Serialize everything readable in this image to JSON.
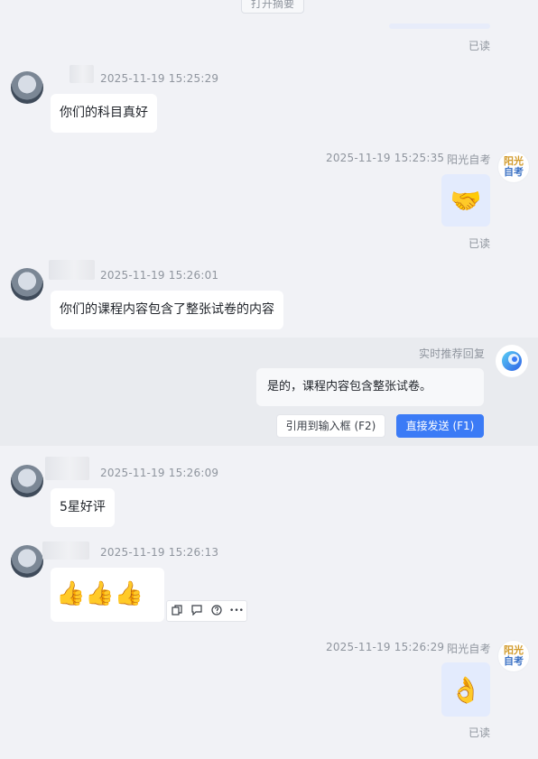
{
  "top": {
    "summary_button": "打开摘要",
    "read_label": "已读"
  },
  "messages": [
    {
      "timestamp": "2025-11-19 15:25:29",
      "text": "你们的科目真好"
    },
    {
      "timestamp": "2025-11-19 15:25:35",
      "sender": "阳光自考",
      "read": "已读"
    },
    {
      "timestamp": "2025-11-19 15:26:01",
      "text": "你们的课程内容包含了整张试卷的内容"
    },
    {
      "timestamp": "2025-11-19 15:26:09",
      "text": "5星好评"
    },
    {
      "timestamp": "2025-11-19 15:26:13"
    },
    {
      "timestamp": "2025-11-19 15:26:29",
      "sender": "阳光自考",
      "read": "已读"
    }
  ],
  "brand_avatar": {
    "line1": "阳光",
    "line2": "自考",
    "color1": "#d29b2c",
    "color2": "#3d73c5"
  },
  "recommend": {
    "label": "实时推荐回复",
    "text": "是的，课程内容包含整张试卷。",
    "quote_button": "引用到输入框 (F2)",
    "send_button": "直接发送 (F1)",
    "accent": "#3b7bf6"
  },
  "toolbar": {
    "icons": [
      "copy-icon",
      "quote-icon",
      "question-icon",
      "more-icon"
    ],
    "more": "•••"
  },
  "emoji": {
    "handshake": "🤝",
    "thumbs": "👍",
    "ok": "👌"
  }
}
